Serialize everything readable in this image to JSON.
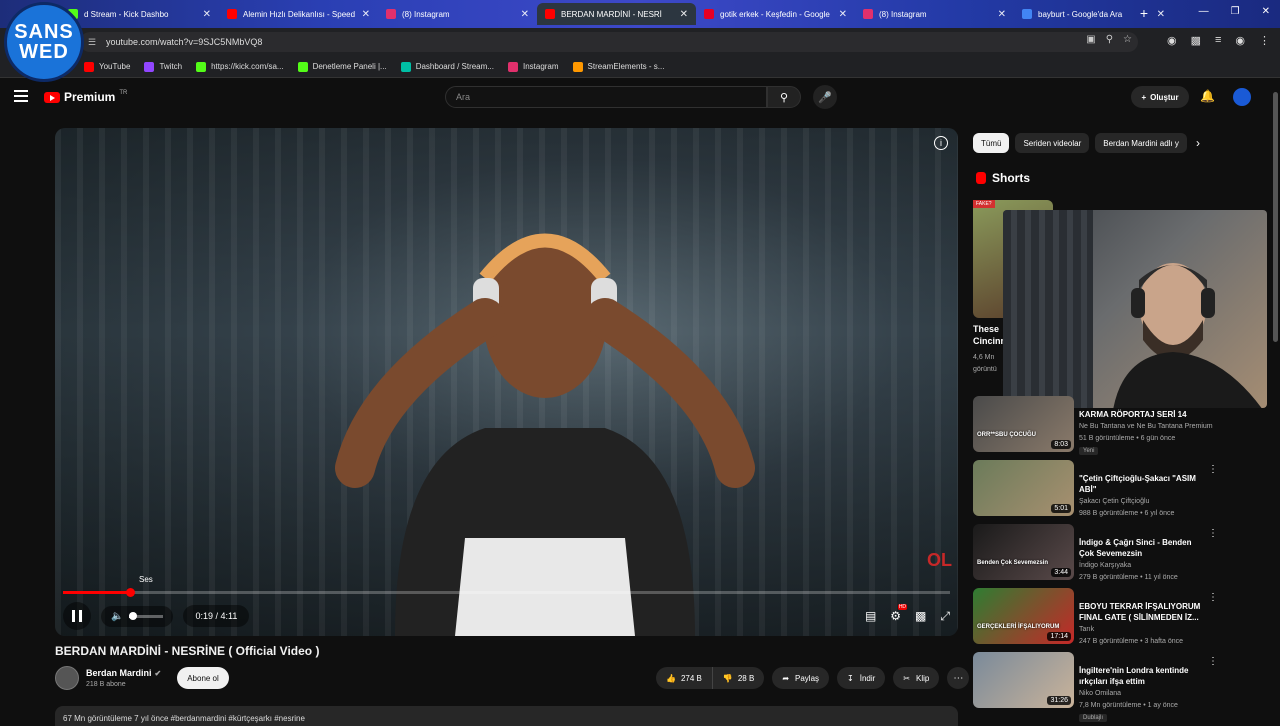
{
  "browser": {
    "tabs": [
      {
        "title": "d Stream - Kick Dashbo",
        "color": "#53fc18"
      },
      {
        "title": "Alemin Hızlı Delikanlısı - Speed",
        "color": "#ff0000"
      },
      {
        "title": "(8) Instagram",
        "color": "#e1306c"
      },
      {
        "title": "BERDAN MARDİNİ - NESRİ",
        "color": "#ff0000"
      },
      {
        "title": "gotik erkek - Keşfedin - Google",
        "color": "#e60023"
      },
      {
        "title": "(8) Instagram",
        "color": "#e1306c"
      },
      {
        "title": "bayburt - Google'da Ara",
        "color": "#4285f4"
      }
    ],
    "url": "youtube.com/watch?v=9SJC5NMbVQ8",
    "bookmarks": [
      {
        "label": "YouTube",
        "color": "#ff0000"
      },
      {
        "label": "Twitch",
        "color": "#9146ff"
      },
      {
        "label": "https://kick.com/sa...",
        "color": "#53fc18"
      },
      {
        "label": "Denetleme Paneli |...",
        "color": "#53fc18"
      },
      {
        "label": "Dashboard / Stream...",
        "color": "#00bfa5"
      },
      {
        "label": "Instagram",
        "color": "#e1306c"
      },
      {
        "label": "StreamElements - s...",
        "color": "#ff9800"
      }
    ]
  },
  "overlay_logo": {
    "line1": "SANS",
    "line2": "WED"
  },
  "youtube": {
    "logo_text": "Premium",
    "logo_tr": "TR",
    "search_placeholder": "Ara",
    "create_label": "Oluştur"
  },
  "player": {
    "tooltip": "Ses",
    "time": "0:19 / 4:11",
    "progress_fraction": 0.075,
    "volume_fraction": 0.1,
    "watermark": "OL"
  },
  "video": {
    "title": "BERDAN MARDİNİ - NESRİNE ( Official Video )",
    "channel": "Berdan Mardini",
    "subscribers": "218 B abone",
    "subscribe_label": "Abone ol",
    "likes": "274 B",
    "dislikes": "28 B",
    "share_label": "Paylaş",
    "download_label": "İndir",
    "clip_label": "Klip",
    "description_peek": "67 Mn görüntüleme  7 yıl önce  #berdanmardini #kürtçeşarkı #nesrine"
  },
  "sidebar": {
    "chips": [
      "Tümü",
      "Seriden videolar",
      "Berdan Mardini adlı y"
    ],
    "shorts_title": "Shorts",
    "short": {
      "tag": "FAKE?",
      "title": "These Cincinn",
      "meta": "4,6 Mn görüntü"
    },
    "recs": [
      {
        "title": "KARMA RÖPORTAJ SERİ 14",
        "channel": "Ne Bu Tantana ve Ne Bu Tantana Premium",
        "meta": "51 B görüntüleme • 6 gün önce",
        "duration": "8:03",
        "badge": "Yeni",
        "thumb_text": "ORR**SBU ÇOCUĞU"
      },
      {
        "title": "\"Çetin Çiftçioğlu-Şakacı \"ASIM ABİ\"",
        "channel": "Şakacı Çetin Çiftçioğlu",
        "meta": "988 B görüntüleme • 6 yıl önce",
        "duration": "5:01",
        "badge": "",
        "thumb_text": ""
      },
      {
        "title": "İndigo & Çağrı Sinci - Benden Çok Sevemezsin",
        "channel": "İndigo Karşıyaka",
        "meta": "279 B görüntüleme • 11 yıl önce",
        "duration": "3:44",
        "badge": "",
        "thumb_text": "Benden Çok Sevemezsin"
      },
      {
        "title": "EBOYU TEKRAR İFŞALIYORUM FINAL GATE ( SİLİNMEDEN İZ...",
        "channel": "Tarık",
        "meta": "247 B görüntüleme • 3 hafta önce",
        "duration": "17:14",
        "badge": "",
        "thumb_text": "GERÇEKLERİ İFŞALIYORUM"
      },
      {
        "title": "İngiltere'nin Londra kentinde ırkçıları ifşa ettim",
        "channel": "Niko Omilana",
        "meta": "7,8 Mn görüntüleme • 1 ay önce",
        "duration": "31:26",
        "badge": "Dublajlı",
        "thumb_text": ""
      }
    ]
  }
}
